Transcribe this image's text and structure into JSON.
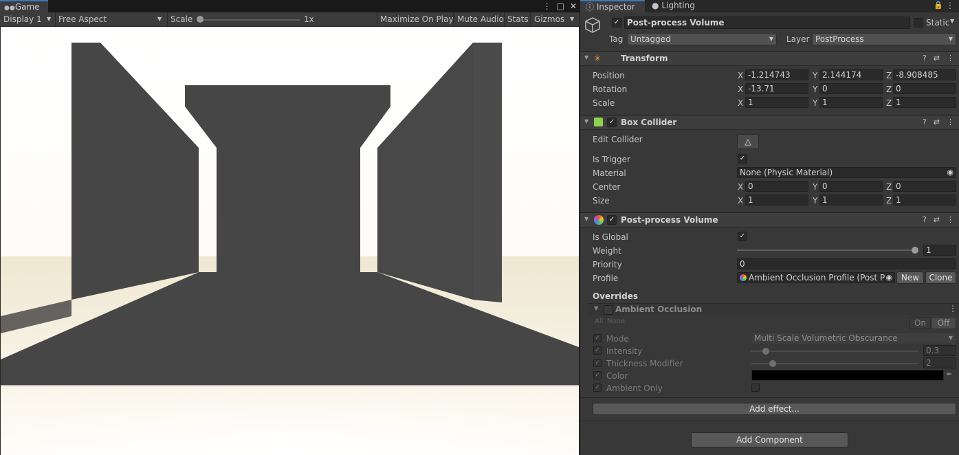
{
  "game": {
    "tab_label": "Game",
    "toolbar": {
      "display": "Display 1",
      "aspect": "Free Aspect",
      "scale_label": "Scale",
      "scale_value": "1x",
      "maximize": "Maximize On Play",
      "mute": "Mute Audio",
      "stats": "Stats",
      "gizmos": "Gizmos"
    }
  },
  "inspector": {
    "tabs": {
      "inspector": "Inspector",
      "lighting": "Lighting"
    },
    "object": {
      "name": "Post-process Volume",
      "static_label": "Static",
      "tag_label": "Tag",
      "tag_value": "Untagged",
      "layer_label": "Layer",
      "layer_value": "PostProcess"
    },
    "transform": {
      "title": "Transform",
      "rows": [
        {
          "label": "Position",
          "x": "-1.214743",
          "y": "2.144174",
          "z": "-8.908485"
        },
        {
          "label": "Rotation",
          "x": "-13.71",
          "y": "0",
          "z": "0"
        },
        {
          "label": "Scale",
          "x": "1",
          "y": "1",
          "z": "1"
        }
      ]
    },
    "axis": {
      "x": "X",
      "y": "Y",
      "z": "Z"
    },
    "box_collider": {
      "title": "Box Collider",
      "edit_collider": "Edit Collider",
      "is_trigger": "Is Trigger",
      "material_label": "Material",
      "material_value": "None (Physic Material)",
      "center": {
        "label": "Center",
        "x": "0",
        "y": "0",
        "z": "0"
      },
      "size": {
        "label": "Size",
        "x": "1",
        "y": "1",
        "z": "1"
      }
    },
    "ppv": {
      "title": "Post-process Volume",
      "is_global": "Is Global",
      "weight_label": "Weight",
      "weight_value": "1",
      "priority_label": "Priority",
      "priority_value": "0",
      "profile_label": "Profile",
      "profile_value": "Ambient Occlusion Profile (Post Prc",
      "new_btn": "New",
      "clone_btn": "Clone",
      "overrides": "Overrides",
      "ao": {
        "title": "Ambient Occlusion",
        "all": "All",
        "none": "None",
        "on": "On",
        "off": "Off",
        "mode_label": "Mode",
        "mode_value": "Multi Scale Volumetric Obscurance",
        "intensity_label": "Intensity",
        "intensity_value": "0.3",
        "thickness_label": "Thickness Modifier",
        "thickness_value": "2",
        "color_label": "Color",
        "color_value": "#000000",
        "ambient_only_label": "Ambient Only"
      }
    },
    "add_effect": "Add effect...",
    "add_component": "Add Component"
  },
  "colors": {
    "accent": "#3a79bb",
    "panel": "#383838",
    "wall": "#464646",
    "floor": "#f5eedc"
  }
}
